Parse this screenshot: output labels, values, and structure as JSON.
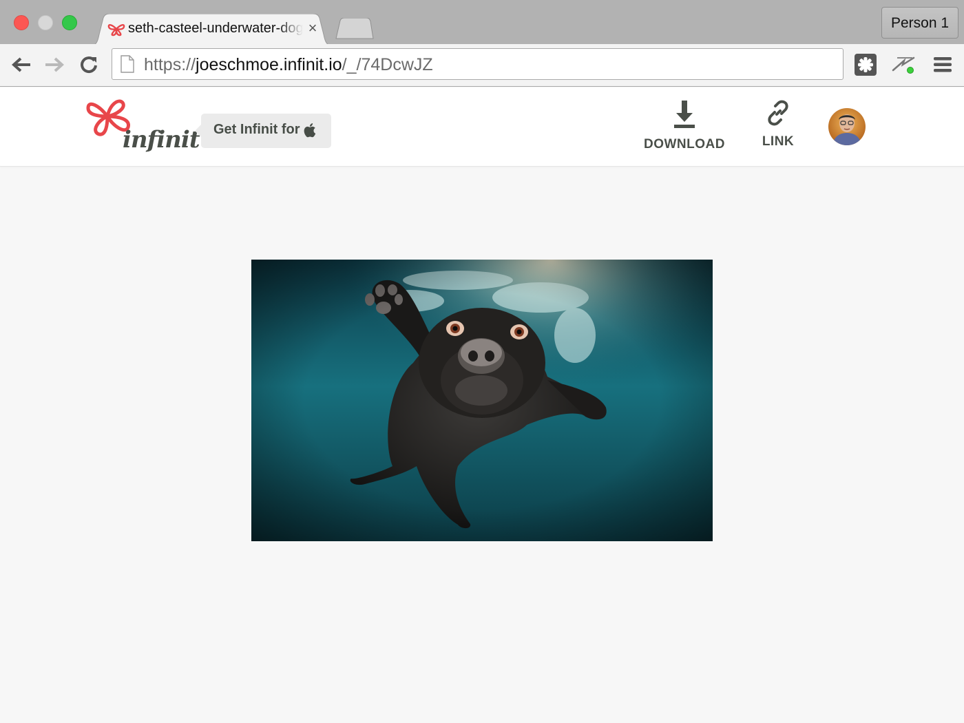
{
  "browser": {
    "tab": {
      "title": "seth-casteel-underwater-dog",
      "close_glyph": "×"
    },
    "profile_label": "Person 1",
    "address": {
      "scheme": "https://",
      "host": "joeschmoe.infinit.io",
      "path": "/_/74DcwJZ"
    },
    "icons": [
      "back-arrow-icon",
      "forward-arrow-icon",
      "reload-icon",
      "page-icon",
      "extension-puzzle-icon",
      "extension-bolt-icon",
      "menu-icon"
    ]
  },
  "site": {
    "logo_text": "infinit",
    "get_button_label": "Get Infinit for",
    "actions": {
      "download_label": "DOWNLOAD",
      "link_label": "LINK"
    },
    "colors": {
      "brand": "#e8464a",
      "text": "#4a4f49",
      "background": "#f7f7f7"
    }
  }
}
